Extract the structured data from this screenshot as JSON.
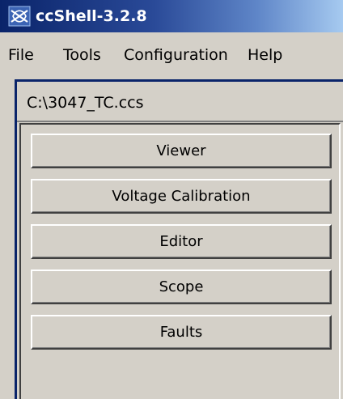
{
  "window": {
    "title": "ccShell-3.2.8",
    "icon": "ccshell-app-icon"
  },
  "menubar": {
    "items": [
      {
        "label": "File"
      },
      {
        "label": "Tools"
      },
      {
        "label": "Configuration"
      },
      {
        "label": "Help"
      }
    ]
  },
  "file_path": "C:\\3047_TC.ccs",
  "buttons": [
    {
      "label": "Viewer"
    },
    {
      "label": "Voltage Calibration"
    },
    {
      "label": "Editor"
    },
    {
      "label": "Scope"
    },
    {
      "label": "Faults"
    }
  ],
  "colors": {
    "title_bar_start": "#0a246a",
    "title_bar_end": "#a6caf0",
    "face": "#d4d0c8"
  }
}
